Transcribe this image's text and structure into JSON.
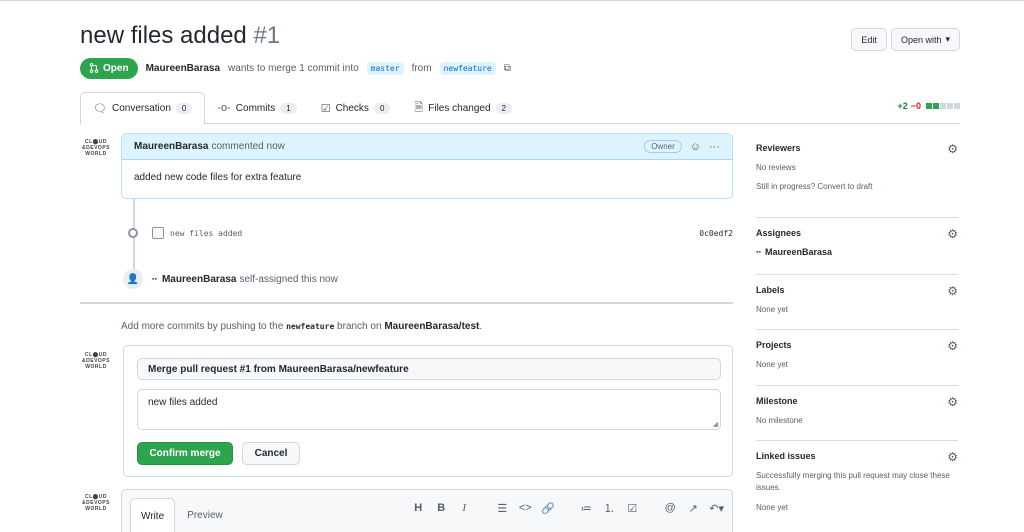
{
  "pr": {
    "title": "new files added",
    "number": "#1",
    "state": "Open",
    "author": "MaureenBarasa",
    "merge_text": "wants to merge 1 commit into",
    "base_branch": "master",
    "from_text": "from",
    "head_branch": "newfeature"
  },
  "header_buttons": {
    "edit": "Edit",
    "open_with": "Open with"
  },
  "tabs": [
    {
      "label": "Conversation",
      "count": "0"
    },
    {
      "label": "Commits",
      "count": "1"
    },
    {
      "label": "Checks",
      "count": "0"
    },
    {
      "label": "Files changed",
      "count": "2"
    }
  ],
  "diffstat": {
    "additions": "+2",
    "deletions": "−0"
  },
  "comment": {
    "author": "MaureenBarasa",
    "action": "commented now",
    "badge": "Owner",
    "body": "added new code files for extra feature"
  },
  "commit": {
    "message": "new files added",
    "sha": "0c0edf2"
  },
  "event": {
    "actor": "MaureenBarasa",
    "text": "self-assigned this now"
  },
  "hint": {
    "prefix": "Add more commits by pushing to the",
    "branch": "newfeature",
    "middle": "branch on",
    "repo": "MaureenBarasa/test",
    "suffix": "."
  },
  "merge": {
    "title": "Merge pull request #1 from MaureenBarasa/newfeature",
    "message": "new files added",
    "confirm": "Confirm merge",
    "cancel": "Cancel"
  },
  "avatar_logo": {
    "line1": "CL⬤UD",
    "line2": "&DEVOPS",
    "line3": "WORLD"
  },
  "editor": {
    "write": "Write",
    "preview": "Preview"
  },
  "sidebar": {
    "reviewers": {
      "title": "Reviewers",
      "value": "No reviews",
      "extra": "Still in progress? Convert to draft"
    },
    "assignees": {
      "title": "Assignees",
      "value": "MaureenBarasa"
    },
    "labels": {
      "title": "Labels",
      "value": "None yet"
    },
    "projects": {
      "title": "Projects",
      "value": "None yet"
    },
    "milestone": {
      "title": "Milestone",
      "value": "No milestone"
    },
    "linked_issues": {
      "title": "Linked issues",
      "value": "Successfully merging this pull request may close these issues.",
      "extra": "None yet"
    }
  },
  "colors": {
    "open_green": "#2da44e",
    "link_blue": "#0969da",
    "branch_bg": "#ddf4ff"
  }
}
